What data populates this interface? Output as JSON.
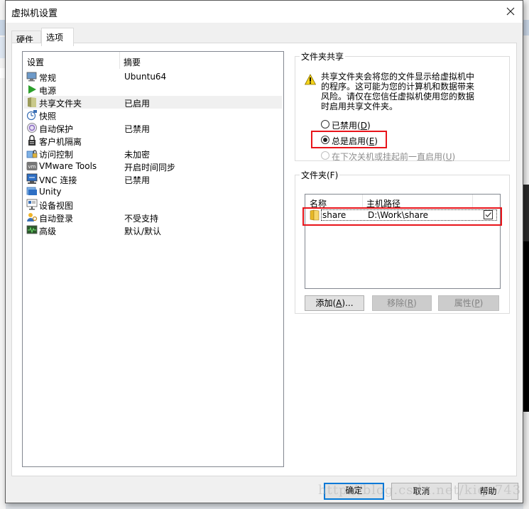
{
  "window": {
    "title": "虚拟机设置",
    "close_icon": "close-icon"
  },
  "tabs": [
    {
      "label": "硬件",
      "active": false
    },
    {
      "label": "选项",
      "active": true
    }
  ],
  "settings_list": {
    "columns": [
      "设置",
      "摘要"
    ],
    "items": [
      {
        "icon": "monitor-icon",
        "name": "常规",
        "summary": "Ubuntu64"
      },
      {
        "icon": "power-play-icon",
        "name": "电源",
        "summary": ""
      },
      {
        "icon": "shared-folder-icon",
        "name": "共享文件夹",
        "summary": "已启用",
        "selected": true
      },
      {
        "icon": "snapshot-icon",
        "name": "快照",
        "summary": ""
      },
      {
        "icon": "autoprotect-icon",
        "name": "自动保护",
        "summary": "已禁用"
      },
      {
        "icon": "lock-icon",
        "name": "客户机隔离",
        "summary": ""
      },
      {
        "icon": "access-control-icon",
        "name": "访问控制",
        "summary": "未加密"
      },
      {
        "icon": "vmware-tools-icon",
        "name": "VMware Tools",
        "summary": "开启时间同步"
      },
      {
        "icon": "vnc-icon",
        "name": "VNC 连接",
        "summary": "已禁用"
      },
      {
        "icon": "unity-icon",
        "name": "Unity",
        "summary": ""
      },
      {
        "icon": "device-view-icon",
        "name": "设备视图",
        "summary": ""
      },
      {
        "icon": "autologin-icon",
        "name": "自动登录",
        "summary": "不受支持"
      },
      {
        "icon": "advanced-icon",
        "name": "高级",
        "summary": "默认/默认"
      }
    ]
  },
  "folder_sharing": {
    "legend": "文件夹共享",
    "warning_icon": "warning-icon",
    "warning_lines": [
      "共享文件夹会将您的文件显示给虚拟机中",
      "的程序。这可能为您的计算机和数据带来",
      "风险。请仅在您信任虚拟机使用您的数据",
      "时启用共享文件夹。"
    ],
    "options": [
      {
        "label": "已禁用(",
        "key": "D",
        "suffix": ")",
        "checked": false,
        "disabled": false
      },
      {
        "label": "总是启用(",
        "key": "E",
        "suffix": ")",
        "checked": true,
        "disabled": false
      },
      {
        "label": "在下次关机或挂起前一直启用(",
        "key": "U",
        "suffix": ")",
        "checked": false,
        "disabled": true
      }
    ]
  },
  "folders": {
    "legend": "文件夹(F)",
    "columns": [
      "名称",
      "主机路径"
    ],
    "rows": [
      {
        "icon": "folder-icon",
        "name": "share",
        "path": "D:\\Work\\share",
        "enabled": true
      }
    ],
    "buttons": [
      {
        "label": "添加(",
        "key": "A",
        "suffix": ")...",
        "disabled": false
      },
      {
        "label": "移除(",
        "key": "R",
        "suffix": ")",
        "disabled": true
      },
      {
        "label": "属性(",
        "key": "P",
        "suffix": ")",
        "disabled": true
      }
    ]
  },
  "footer": {
    "ok": "确定",
    "cancel": "取消",
    "help": "帮助"
  },
  "watermark": "http://blog.csdn.net/kiqo743",
  "colors": {
    "highlight": "#e8141a",
    "focus_blue": "#0078d7"
  }
}
